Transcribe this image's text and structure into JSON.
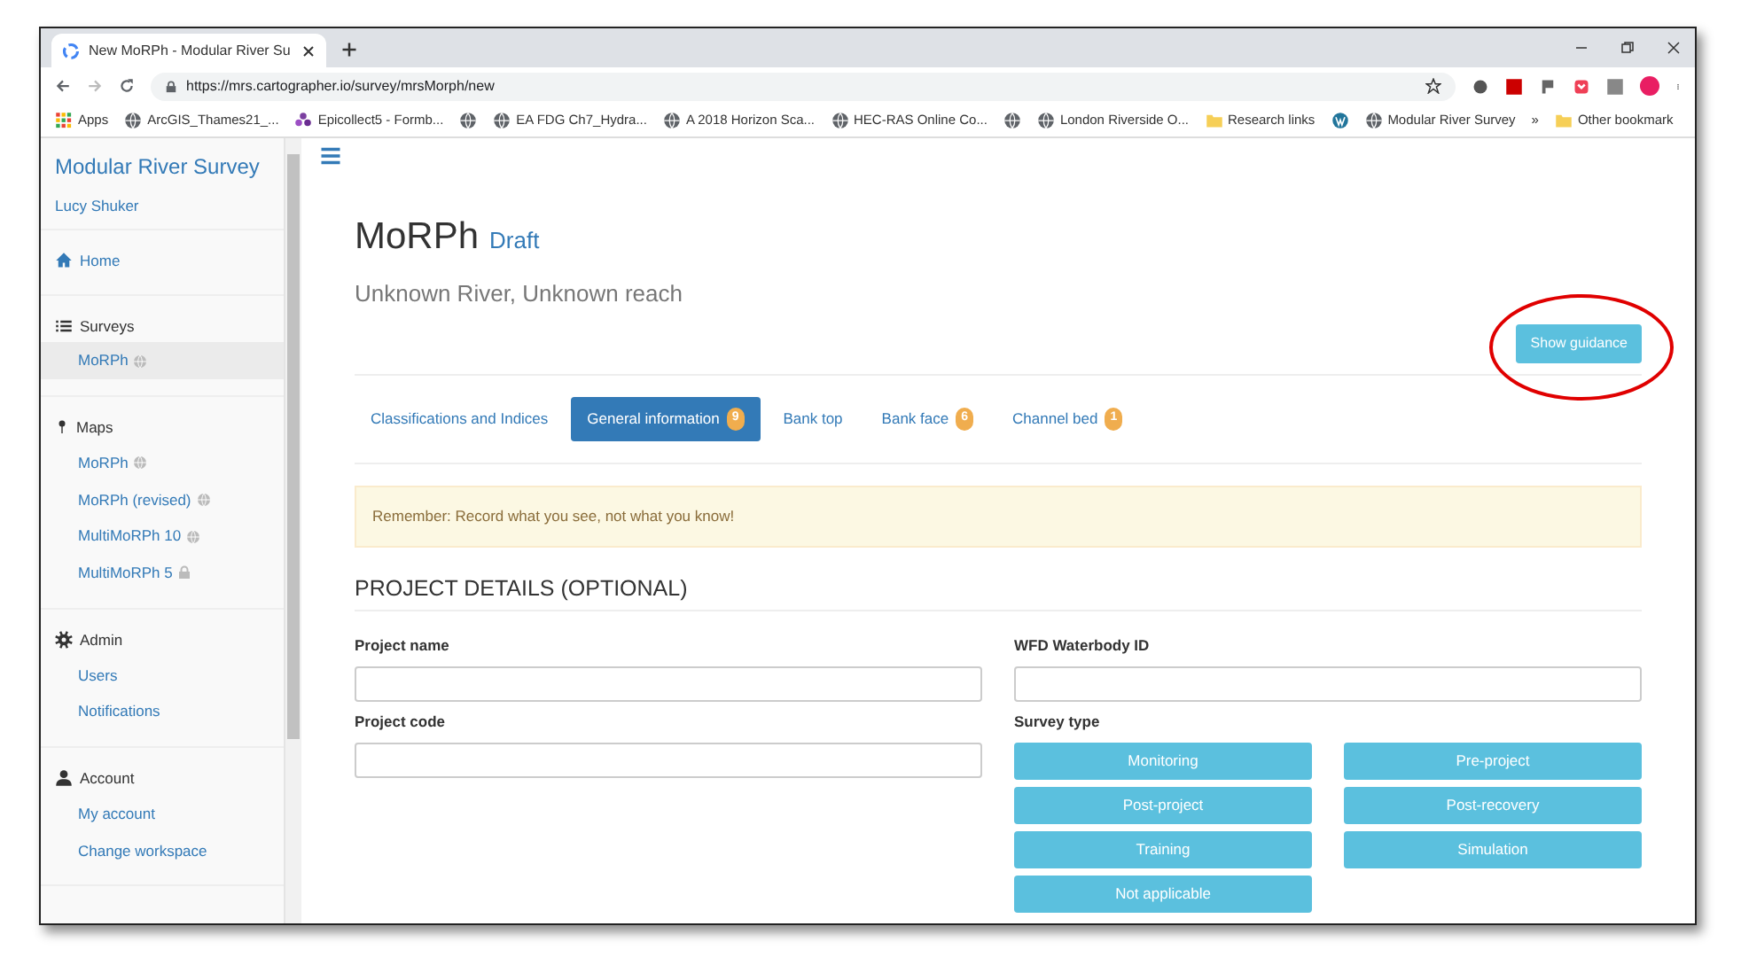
{
  "browser": {
    "tab_title": "New MoRPh - Modular River Su",
    "url": "https://mrs.cartographer.io/survey/mrsMorph/new",
    "bookmarks": [
      {
        "kind": "apps",
        "label": "Apps"
      },
      {
        "kind": "globe",
        "label": "ArcGIS_Thames21_..."
      },
      {
        "kind": "flower",
        "label": "Epicollect5 - Formb..."
      },
      {
        "kind": "globe"
      },
      {
        "kind": "globe",
        "label": "EA FDG Ch7_Hydra..."
      },
      {
        "kind": "globe",
        "label": "A 2018 Horizon Sca..."
      },
      {
        "kind": "globe",
        "label": "HEC-RAS Online Co..."
      },
      {
        "kind": "globe"
      },
      {
        "kind": "globe",
        "label": "London Riverside O..."
      },
      {
        "kind": "folder",
        "label": "Research links"
      },
      {
        "kind": "wordpress"
      },
      {
        "kind": "globe",
        "label": "Modular River Survey"
      },
      {
        "kind": "more",
        "label": "»"
      },
      {
        "kind": "folder",
        "label": "Other bookmark"
      }
    ]
  },
  "sidebar": {
    "title": "Modular River Survey",
    "user": "Lucy Shuker",
    "sections": [
      {
        "kind": "link",
        "heading": "Home"
      },
      {
        "kind": "group",
        "heading": "Surveys",
        "items": [
          {
            "label": "MoRPh",
            "kind": "public",
            "selected": true
          }
        ]
      },
      {
        "kind": "group",
        "heading": "Maps",
        "items": [
          {
            "label": "MoRPh",
            "kind": "public",
            "selected": false
          },
          {
            "label": "MoRPh (revised)",
            "kind": "public",
            "selected": false
          },
          {
            "label": "MultiMoRPh 10",
            "kind": "public",
            "selected": false
          },
          {
            "label": "MultiMoRPh 5",
            "kind": "locked",
            "selected": false
          }
        ]
      },
      {
        "kind": "group",
        "heading": "Admin",
        "items": [
          {
            "label": "Users",
            "kind": "plain",
            "selected": false
          },
          {
            "label": "Notifications",
            "kind": "plain",
            "selected": false
          }
        ]
      },
      {
        "kind": "group",
        "heading": "Account",
        "items": [
          {
            "label": "My account",
            "kind": "plain",
            "selected": false
          },
          {
            "label": "Change workspace",
            "kind": "plain",
            "selected": false
          }
        ]
      }
    ]
  },
  "main": {
    "title": "MoRPh",
    "status": "Draft",
    "subtitle": "Unknown River, Unknown reach",
    "guidance_button": "Show guidance",
    "tabs": [
      {
        "label": "Classifications and Indices",
        "selected": false
      },
      {
        "label": "General information",
        "count": "9",
        "selected": true
      },
      {
        "label": "Bank top",
        "selected": false
      },
      {
        "label": "Bank face",
        "count": "6",
        "selected": false
      },
      {
        "label": "Channel bed",
        "count": "1",
        "selected": false
      }
    ],
    "alert": "Remember: Record what you see, not what you know!",
    "section_heading": "PROJECT DETAILS (OPTIONAL)",
    "fields": [
      {
        "label": "Project name"
      },
      {
        "label": "WFD Waterbody ID"
      },
      {
        "label": "Project code"
      }
    ],
    "survey_type": {
      "label": "Survey type",
      "options": [
        "Monitoring",
        "Pre-project",
        "Post-project",
        "Post-recovery",
        "Training",
        "Simulation",
        "Not applicable"
      ]
    }
  }
}
